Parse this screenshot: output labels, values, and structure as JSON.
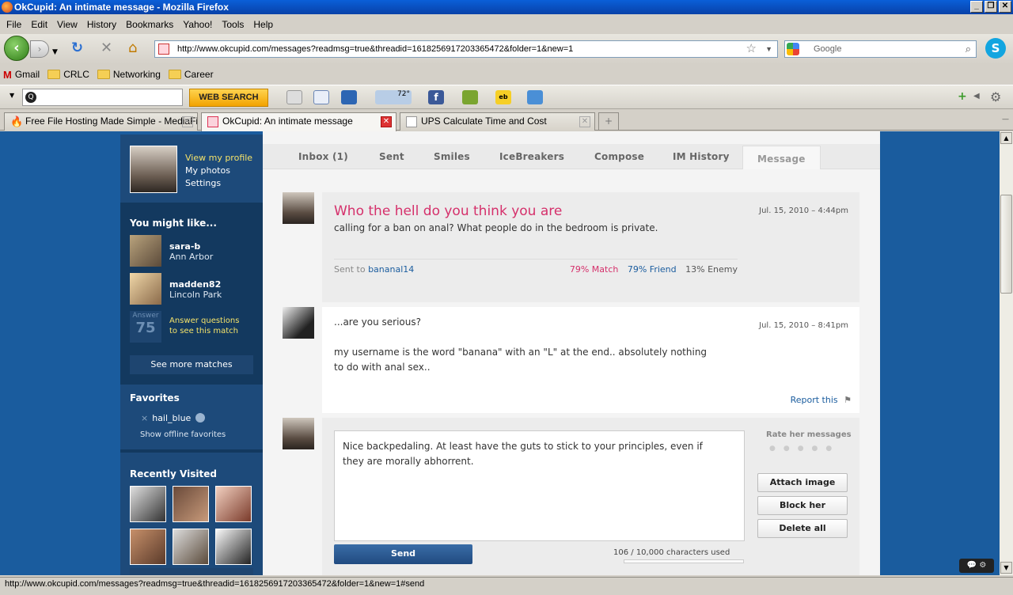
{
  "window": {
    "title": "OkCupid: An intimate message - Mozilla Firefox"
  },
  "menu": [
    "File",
    "Edit",
    "View",
    "History",
    "Bookmarks",
    "Yahoo!",
    "Tools",
    "Help"
  ],
  "nav": {
    "url": "http://www.okcupid.com/messages?readmsg=true&threadid=1618256917203365472&folder=1&new=1",
    "search_placeholder": "Google"
  },
  "bookmarks": [
    "Gmail",
    "CRLC",
    "Networking",
    "Career"
  ],
  "toolbar2": {
    "web_search": "WEB SEARCH",
    "weather": "72°"
  },
  "tabs": [
    {
      "label": "Free File Hosting Made Simple - MediaFire"
    },
    {
      "label": "OkCupid: An intimate message"
    },
    {
      "label": "UPS Calculate Time and Cost"
    }
  ],
  "sidebar": {
    "profile_links": [
      "View my profile",
      "My photos",
      "Settings"
    ],
    "might_like_title": "You might like...",
    "matches": [
      {
        "name": "sara-b",
        "location": "Ann Arbor"
      },
      {
        "name": "madden82",
        "location": "Lincoln Park"
      }
    ],
    "answer_box": {
      "label": "Answer",
      "number": "75"
    },
    "answer_link": [
      "Answer questions",
      "to see this match"
    ],
    "see_more": "See more matches",
    "favorites_title": "Favorites",
    "favorite": "hail_blue",
    "show_offline": "Show offline favorites",
    "recently_visited_title": "Recently Visited"
  },
  "message_tabs": [
    "Inbox (1)",
    "Sent",
    "Smiles",
    "IceBreakers",
    "Compose",
    "IM History",
    "Message"
  ],
  "messages": [
    {
      "title": "Who the hell do you think you are",
      "date": "Jul. 15, 2010 – 4:44pm",
      "body": "calling for a ban on anal? What people do in the bedroom is private.",
      "sent_to_label": "Sent to",
      "sent_to": "bananal14",
      "match": "79% Match",
      "friend": "79% Friend",
      "enemy": "13% Enemy"
    },
    {
      "date": "Jul. 15, 2010 – 8:41pm",
      "line1": "...are you serious?",
      "line2": "my username is the word \"banana\" with an \"L\" at the end.. absolutely nothing",
      "line3": "to do with anal sex..",
      "report": "Report this"
    }
  ],
  "reply": {
    "text_line1": "Nice backpedaling. At least have the guts to stick to your principles, even if",
    "text_line2": "they are morally abhorrent.",
    "rate_label": "Rate her messages",
    "buttons": [
      "Attach image",
      "Block her",
      "Delete all"
    ],
    "send": "Send",
    "chars_used": "106 / 10,000 characters used"
  },
  "status_bar": "http://www.okcupid.com/messages?readmsg=true&threadid=1618256917203365472&folder=1&new=1#send"
}
